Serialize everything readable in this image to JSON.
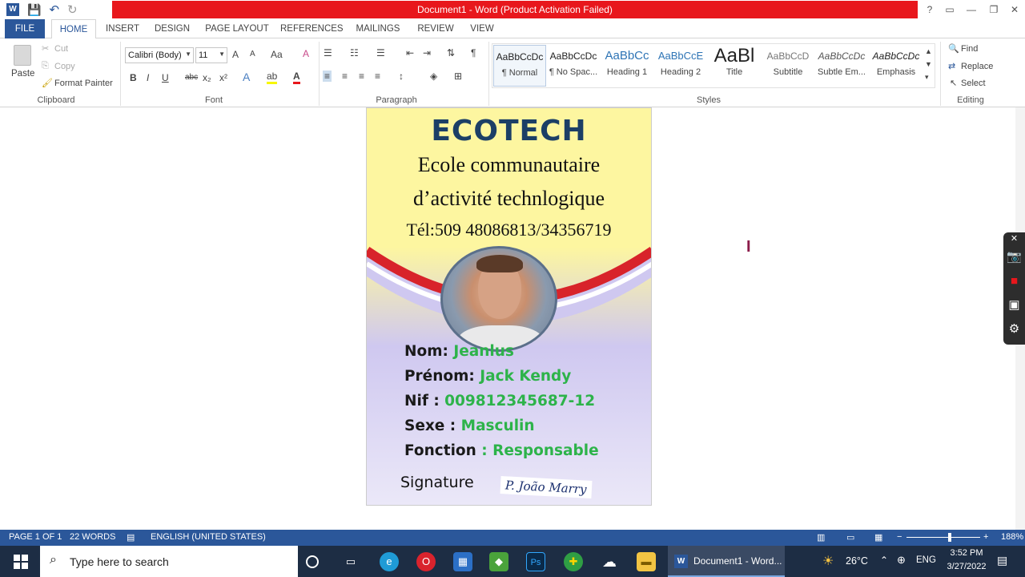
{
  "window": {
    "title": "Document1 - Word (Product Activation Failed)"
  },
  "tabs": [
    "FILE",
    "HOME",
    "INSERT",
    "DESIGN",
    "PAGE LAYOUT",
    "REFERENCES",
    "MAILINGS",
    "REVIEW",
    "VIEW"
  ],
  "clipboard": {
    "paste": "Paste",
    "cut": "Cut",
    "copy": "Copy",
    "format_painter": "Format Painter",
    "label": "Clipboard"
  },
  "font": {
    "name": "Calibri (Body)",
    "size": "11",
    "label": "Font",
    "bold": "B",
    "italic": "I",
    "underline": "U",
    "strike": "abc",
    "sub": "x₂",
    "sup": "x²",
    "grow": "A",
    "shrink": "A",
    "case": "Aa"
  },
  "paragraph": {
    "label": "Paragraph"
  },
  "styles": {
    "label": "Styles",
    "items": [
      {
        "preview": "AaBbCcDc",
        "name": "¶ Normal"
      },
      {
        "preview": "AaBbCcDc",
        "name": "¶ No Spac..."
      },
      {
        "preview": "AaBbCc",
        "name": "Heading 1"
      },
      {
        "preview": "AaBbCcE",
        "name": "Heading 2"
      },
      {
        "preview": "AaBl",
        "name": "Title"
      },
      {
        "preview": "AaBbCcD",
        "name": "Subtitle"
      },
      {
        "preview": "AaBbCcDc",
        "name": "Subtle Em..."
      },
      {
        "preview": "AaBbCcDc",
        "name": "Emphasis"
      }
    ]
  },
  "editing": {
    "label": "Editing",
    "find": "Find",
    "replace": "Replace",
    "select": "Select"
  },
  "card": {
    "brand": "ECOTECH",
    "line1": "Ecole communautaire",
    "line2": "d’activité technlogique",
    "tel": "Tél:509 48086813/34356719",
    "fields": [
      {
        "label": "Nom:",
        "value": "Jeanlus"
      },
      {
        "label": "Prénom:",
        "value": "Jack Kendy"
      },
      {
        "label": "Nif :",
        "value": "009812345687-12"
      },
      {
        "label": "Sexe :",
        "value": "Masculin"
      },
      {
        "label": "Fonction",
        "value": ": Responsable"
      }
    ],
    "signature_label": "Signature",
    "signature": "P. João Marry"
  },
  "status": {
    "page": "PAGE 1 OF 1",
    "words": "22 WORDS",
    "language": "ENGLISH (UNITED STATES)",
    "zoom": "188%"
  },
  "taskbar": {
    "search": "Type here to search",
    "word_task": "Document1 - Word...",
    "temp": "26°C",
    "lang": "ENG",
    "time": "3:52 PM",
    "date": "3/27/2022"
  },
  "colors": {
    "ribbon_blue": "#2b579a",
    "title_red": "#e8171c",
    "card_green": "#2db34a",
    "card_navy": "#1c3f66"
  }
}
